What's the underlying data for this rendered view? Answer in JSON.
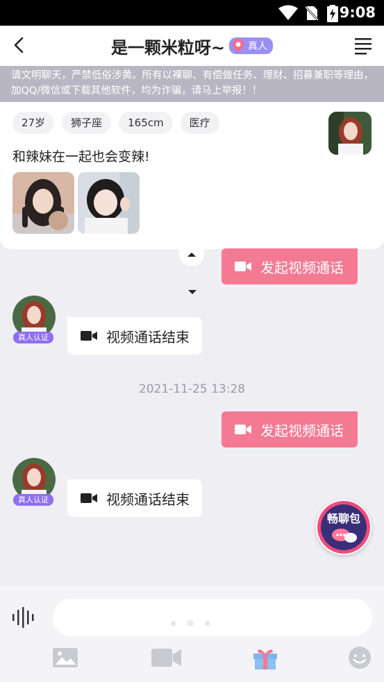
{
  "status_bar": {
    "time": "9:08"
  },
  "header": {
    "title": "是一颗米粒呀~",
    "real_badge": "真人"
  },
  "notice": {
    "text": "请文明聊天，严禁低俗涉黄。所有以裸聊、有偿做任务、理财、招募兼职等理由，加QQ/微信或下载其他软件，均为诈骗，请马上举报！！"
  },
  "profile": {
    "tags": [
      "27岁",
      "狮子座",
      "165cm",
      "医疗"
    ],
    "bio": "和辣妹在一起也会变辣!"
  },
  "messages": [
    {
      "id": "m1",
      "direction": "out",
      "text": "发起视频通话"
    },
    {
      "id": "m2",
      "direction": "in",
      "text": "视频通话结束",
      "verified_label": "真人认证"
    },
    {
      "id": "ts1",
      "type": "timestamp",
      "text": "2021-11-25 13:28"
    },
    {
      "id": "m3",
      "direction": "out",
      "text": "发起视频通话"
    },
    {
      "id": "m4",
      "direction": "in",
      "text": "视频通话结束",
      "verified_label": "真人认证"
    }
  ],
  "float_button": {
    "label": "畅聊包"
  },
  "colors": {
    "accent_pink": "#f47a93",
    "badge_purple": "#8f6ff0",
    "background": "#efeef3"
  },
  "icons": [
    "back-arrow-icon",
    "menu-icon",
    "video-camera-icon",
    "voice-wave-icon",
    "image-icon",
    "video-icon",
    "gift-icon",
    "emoji-icon"
  ]
}
